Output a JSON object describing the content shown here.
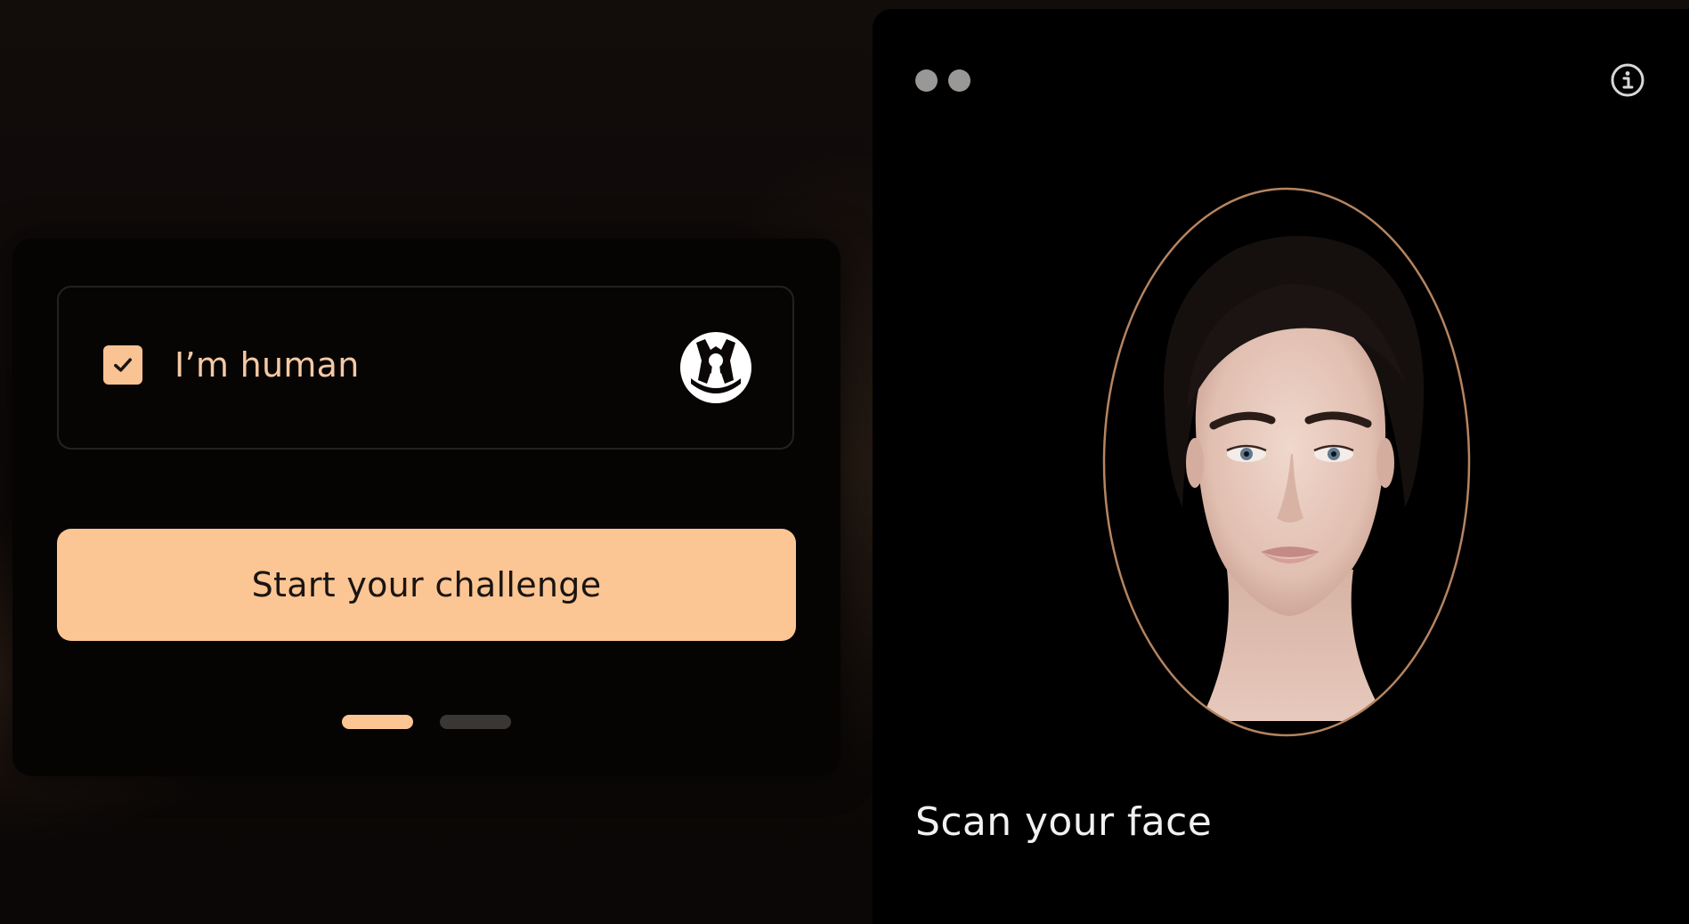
{
  "verification_card": {
    "checkbox": {
      "checked": true,
      "label": "I’m human"
    },
    "logo_icon": "brand-keyhole-shield-icon",
    "start_button_label": "Start your challenge",
    "pager": {
      "total": 2,
      "active_index": 0
    }
  },
  "scan_panel": {
    "menu_icon": "two-dots-icon",
    "info_icon": "info-icon",
    "face_preview": "portrait of a woman inside oval frame",
    "caption": "Scan your face"
  },
  "colors": {
    "accent": "#fbc594",
    "label": "#f4c9a4",
    "card_bg": "#050403",
    "panel_bg": "#000000",
    "oval_border": "#b58460"
  }
}
